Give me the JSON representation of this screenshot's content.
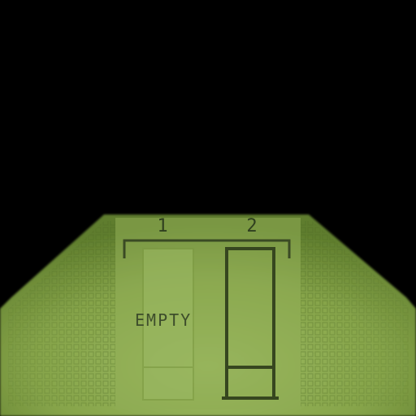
{
  "slots": [
    {
      "number": "1",
      "status": "EMPTY"
    },
    {
      "number": "2",
      "status": ""
    }
  ],
  "colors": {
    "background": "#000000",
    "panel": "#8aa84a",
    "panel_dark": "#6b8a35",
    "ink": "#2f3f1f",
    "slot_empty_fill": "#93b15b"
  }
}
